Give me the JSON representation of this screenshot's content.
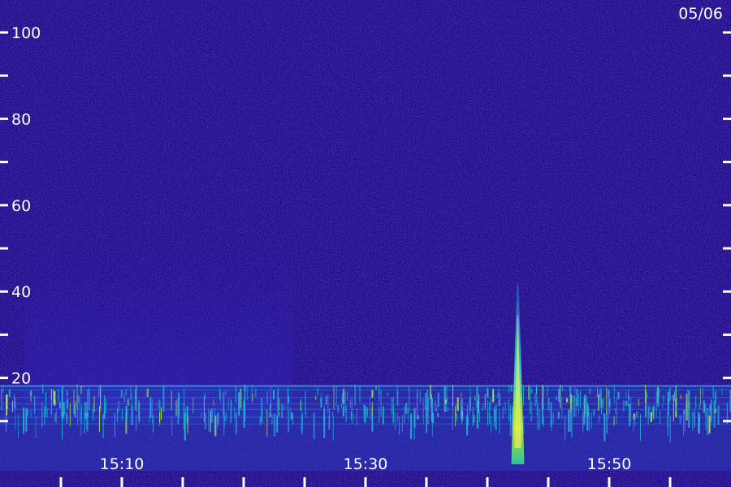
{
  "chart_data": {
    "type": "heatmap",
    "title": "",
    "date": "05/06",
    "xlabel": "",
    "ylabel": "",
    "ylim": [
      0,
      100
    ],
    "y_ticks": [
      100,
      90,
      80,
      70,
      60,
      50,
      40,
      30,
      20,
      10
    ],
    "y_tick_labels": [
      "100",
      "",
      "80",
      "",
      "60",
      "",
      "40",
      "",
      "20",
      ""
    ],
    "x_ticks": [
      {
        "label": "15:10",
        "minute": 10
      },
      {
        "label": "15:30",
        "minute": 30
      },
      {
        "label": "15:50",
        "minute": 50
      }
    ],
    "x_range_minutes": [
      0,
      60
    ],
    "x_minor_tick_count": 12,
    "colors": {
      "background": "#24108a",
      "noise_bright": "#3c2ad0",
      "band_low": "#20c8e0",
      "band_hot": "#d8f020",
      "text": "#ffffff"
    },
    "features": [
      {
        "name": "burst",
        "minute": 42.5,
        "y_from": 0,
        "y_to": 42
      }
    ]
  }
}
